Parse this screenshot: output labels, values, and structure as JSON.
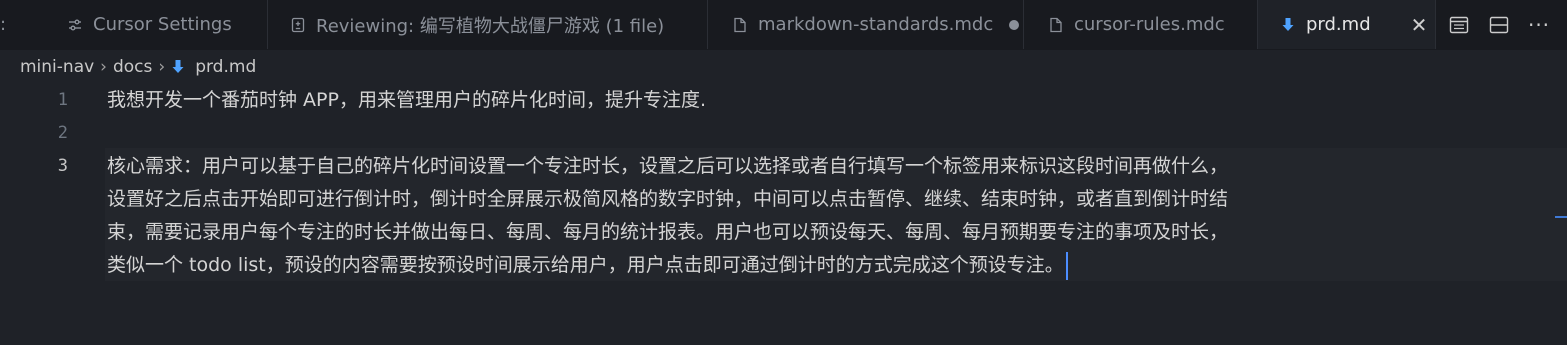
{
  "tabs": [
    {
      "label": "Cursor Settings",
      "icon": "settings-sliders-icon"
    },
    {
      "label": "Reviewing: 编写植物大战僵尸游戏 (1 file)",
      "icon": "review-icon"
    },
    {
      "label": "markdown-standards.mdc",
      "icon": "file-icon",
      "modified": true
    },
    {
      "label": "cursor-rules.mdc",
      "icon": "file-icon"
    },
    {
      "label": "prd.md",
      "icon": "markdown-arrow-icon",
      "active": true
    }
  ],
  "breadcrumb": {
    "part1": "mini-nav",
    "part2": "docs",
    "part3": "prd.md"
  },
  "editor": {
    "line_numbers": [
      "1",
      "2",
      "3"
    ],
    "line1": "我想开发一个番茄时钟 APP，用来管理用户的碎片化时间，提升专注度.",
    "line2": "",
    "line3_wrap1": "核心需求：用户可以基于自己的碎片化时间设置一个专注时长，设置之后可以选择或者自行填写一个标签用来标识这段时间再做什么，",
    "line3_wrap2": "设置好之后点击开始即可进行倒计时，倒计时全屏展示极简风格的数字时钟，中间可以点击暂停、继续、结束时钟，或者直到倒计时结",
    "line3_wrap3": "束，需要记录用户每个专注的时长并做出每日、每周、每月的统计报表。用户也可以预设每天、每周、每月预期要专注的事项及时长，",
    "line3_wrap4": "类似一个 todo list，预设的内容需要按预设时间展示给用户，用户点击即可通过倒计时的方式完成这个预设专注。"
  },
  "colors": {
    "accent": "#4c8dff",
    "markdown_icon": "#4fa3ff"
  }
}
